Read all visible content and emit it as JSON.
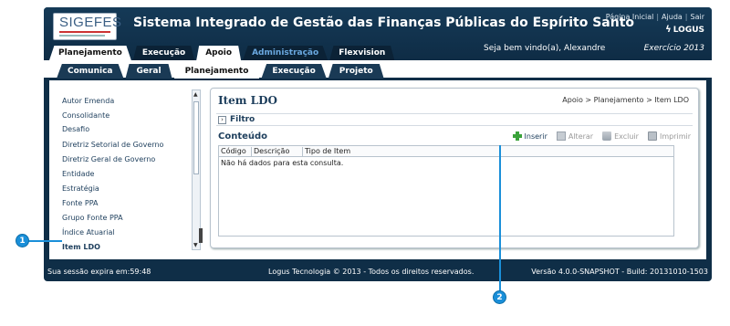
{
  "header": {
    "logo_text": "SIGEFES",
    "title": "Sistema Integrado de Gestão das Finanças Públicas do Espírito Santo",
    "links": [
      "Página Inicial",
      "Ajuda",
      "Sair"
    ],
    "brand": "LOGUS",
    "welcome": "Seja bem vindo(a), Alexandre",
    "exercise": "Exercício 2013"
  },
  "main_tabs": [
    {
      "label": "Planejamento"
    },
    {
      "label": "Execução"
    },
    {
      "label": "Apoio",
      "active": true
    },
    {
      "label": "Administração"
    },
    {
      "label": "Flexvision"
    }
  ],
  "sub_tabs": [
    {
      "label": "Comunica"
    },
    {
      "label": "Geral"
    },
    {
      "label": "Planejamento",
      "active": true
    },
    {
      "label": "Execução"
    },
    {
      "label": "Projeto"
    }
  ],
  "sidebar": {
    "items": [
      {
        "label": "Autor Emenda"
      },
      {
        "label": "Consolidante"
      },
      {
        "label": "Desafio"
      },
      {
        "label": "Diretriz Setorial de Governo"
      },
      {
        "label": "Diretriz Geral de Governo"
      },
      {
        "label": "Entidade"
      },
      {
        "label": "Estratégia"
      },
      {
        "label": "Fonte PPA"
      },
      {
        "label": "Grupo Fonte PPA"
      },
      {
        "label": "Índice Atuarial"
      },
      {
        "label": "Item LDO",
        "current": true
      }
    ]
  },
  "panel": {
    "title": "Item LDO",
    "breadcrumb": "Apoio > Planejamento > Item LDO",
    "filter_label": "Filtro",
    "content_title": "Conteúdo",
    "toolbar": {
      "insert": "Inserir",
      "edit": "Alterar",
      "delete": "Excluir",
      "print": "Imprimir"
    },
    "grid": {
      "columns": [
        "Código",
        "Descrição",
        "Tipo de Item"
      ],
      "empty_message": "Não há dados para esta consulta."
    }
  },
  "footer": {
    "session": "Sua sessão expira em:59:48",
    "copyright": "Logus Tecnologia © 2013 - Todos os direitos reservados.",
    "version": "Versão 4.0.0-SNAPSHOT - Build: 20131010-1503"
  },
  "callouts": [
    "1",
    "2"
  ],
  "colors": {
    "accent": "#1a8fd9",
    "header_bg": "#0f2e47",
    "link": "#1d3e5c",
    "insert_icon": "#3aa23a"
  }
}
